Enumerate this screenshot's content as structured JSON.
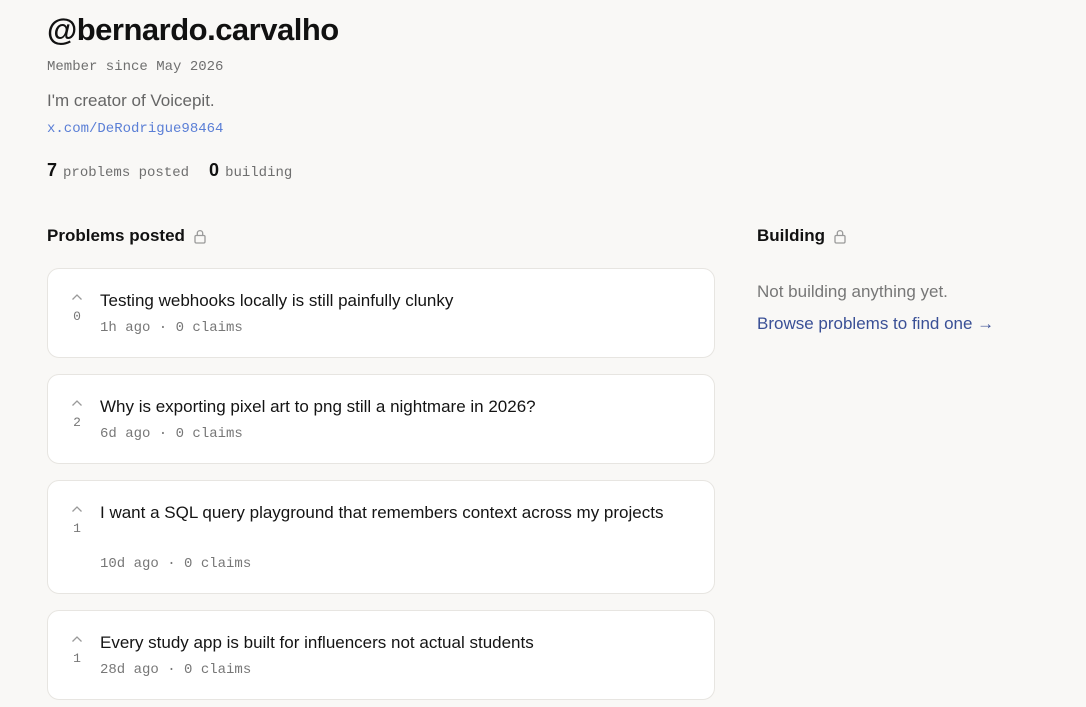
{
  "profile": {
    "username": "@bernardo.carvalho",
    "member_since": "Member since May 2026",
    "bio": "I'm creator of Voicepit.",
    "link": "x.com/DeRodrigue98464"
  },
  "stats": {
    "problems_count": "7",
    "problems_label": "problems posted",
    "building_count": "0",
    "building_label": "building"
  },
  "problems_section": {
    "heading": "Problems posted",
    "icon": "lock-icon",
    "items": [
      {
        "title": "Testing webhooks locally is still painfully clunky",
        "votes": "0",
        "meta": "1h ago · 0 claims"
      },
      {
        "title": "Why is exporting pixel art to png still a nightmare in 2026?",
        "votes": "2",
        "meta": "6d ago · 0 claims"
      },
      {
        "title": "I want a SQL query playground that remembers context across my projects",
        "votes": "1",
        "meta": "10d ago · 0 claims"
      },
      {
        "title": "Every study app is built for influencers not actual students",
        "votes": "1",
        "meta": "28d ago · 0 claims"
      }
    ]
  },
  "building_section": {
    "heading": "Building",
    "icon": "lock-icon",
    "empty_text": "Not building anything yet.",
    "browse_link": "Browse problems to find one →"
  },
  "colors": {
    "background": "#f9f8f6",
    "link": "#5b7fd6",
    "browse_link": "#3a5096",
    "card_border": "#e7e5e1"
  }
}
